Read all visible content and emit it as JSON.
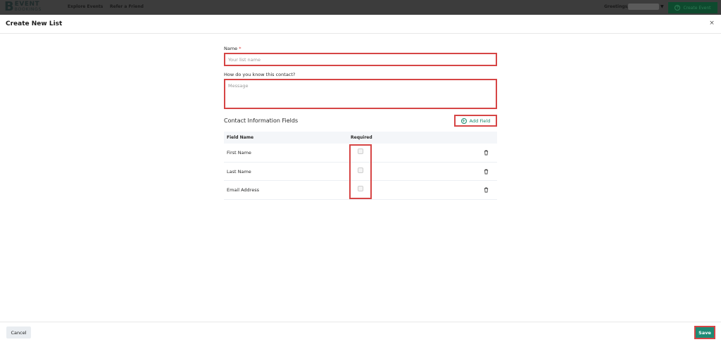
{
  "nav": {
    "logo_letter": "B",
    "logo_line1": "EVENT",
    "logo_line2": "BOOKINGS",
    "explore": "Explore Events",
    "refer": "Refer a Friend",
    "greeting": "Greetings,",
    "create_event": "Create Event"
  },
  "modal": {
    "title": "Create New List",
    "close": "×",
    "name_label": "Name",
    "name_required_mark": "*",
    "name_placeholder": "Your list name",
    "know_label": "How do you know this contact?",
    "message_placeholder": "Message",
    "section_title": "Contact Information Fields",
    "add_field": "Add Field",
    "table": {
      "headers": [
        "Field Name",
        "Required"
      ],
      "rows": [
        {
          "name": "First Name",
          "required": false
        },
        {
          "name": "Last Name",
          "required": false
        },
        {
          "name": "Email Address",
          "required": false
        }
      ]
    },
    "cancel": "Cancel",
    "save": "Save"
  },
  "colors": {
    "accent": "#1e8b75",
    "highlight": "#d64545",
    "nav_bg": "#3c3c3c"
  }
}
